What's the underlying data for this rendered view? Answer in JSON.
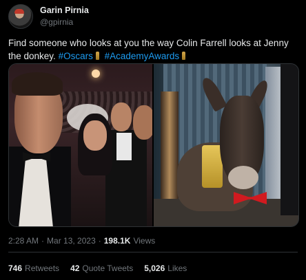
{
  "author": {
    "display_name": "Garin Pirnia",
    "handle": "@gpirnia",
    "avatar_icon": "avatar-icon"
  },
  "tweet": {
    "text_prefix": "Find someone who looks at you the way Colin Farrell looks at Jenny the donkey.",
    "hashtags": [
      "#Oscars",
      "#AcademyAwards"
    ],
    "hashtag_icon": "oscar-statuette-icon",
    "hashtag_color": "#1d9bf0"
  },
  "media": {
    "left_photo": "colin-farrell-photo",
    "right_photo": "jenny-the-donkey-photo"
  },
  "meta": {
    "time": "2:28 AM",
    "separator": "·",
    "date": "Mar 13, 2023",
    "views_count": "198.1K",
    "views_label": "Views"
  },
  "stats": {
    "retweets_count": "746",
    "retweets_label": "Retweets",
    "quotes_count": "42",
    "quotes_label": "Quote Tweets",
    "likes_count": "5,026",
    "likes_label": "Likes"
  },
  "colors": {
    "background": "#000000",
    "text": "#e7e9ea",
    "secondary_text": "#71767b",
    "link": "#1d9bf0",
    "border": "#2f3336"
  }
}
